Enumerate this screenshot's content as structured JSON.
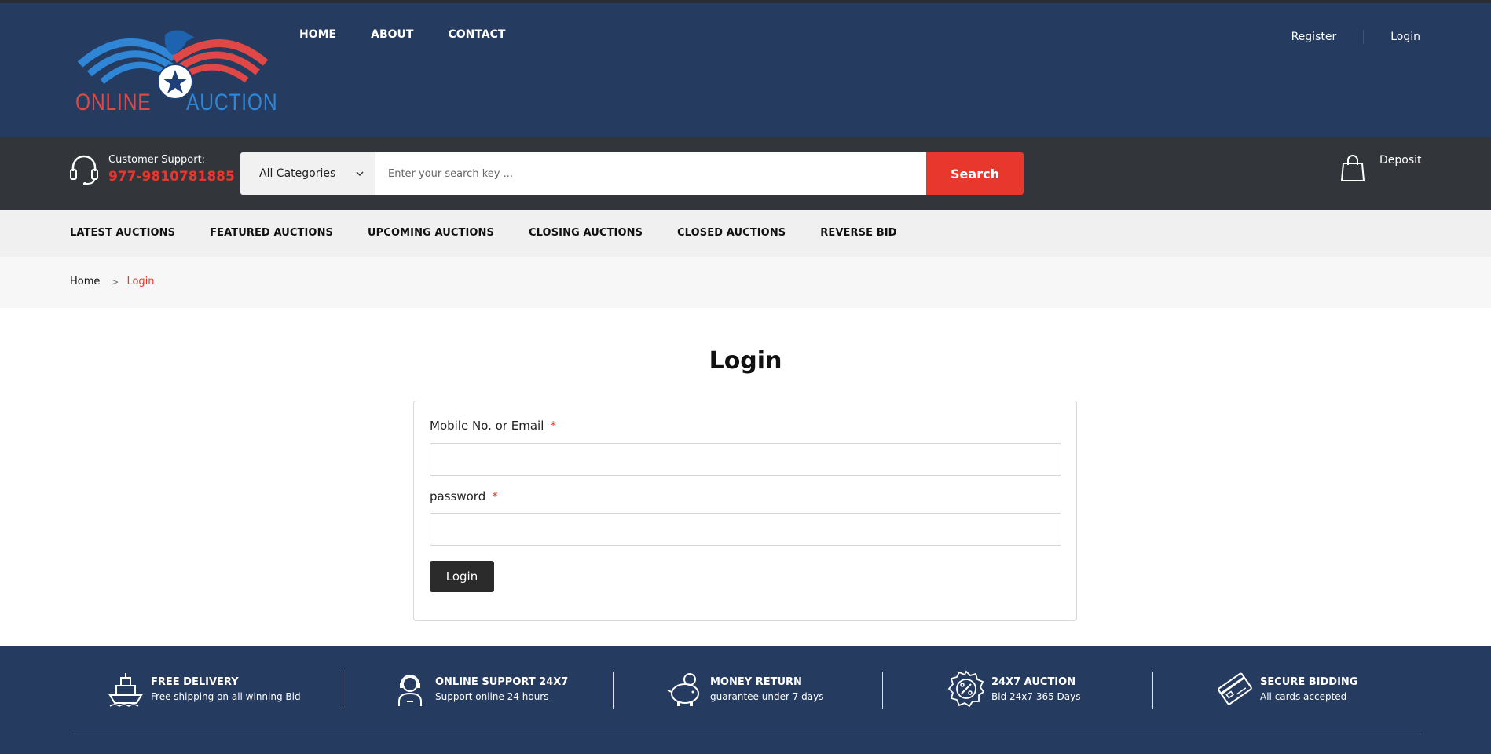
{
  "header": {
    "logo": {
      "word1": "ONLINE",
      "word2": "AUCTION"
    },
    "nav": [
      "HOME",
      "ABOUT",
      "CONTACT"
    ],
    "user_links": {
      "register": "Register",
      "login": "Login"
    }
  },
  "support": {
    "label": "Customer Support:",
    "phone": "977-9810781885"
  },
  "search": {
    "category": "All Categories",
    "placeholder": "Enter your search key ...",
    "button": "Search"
  },
  "deposit": {
    "label": "Deposit"
  },
  "category_nav": [
    "LATEST AUCTIONS",
    "FEATURED AUCTIONS",
    "UPCOMING AUCTIONS",
    "CLOSING AUCTIONS",
    "CLOSED AUCTIONS",
    "REVERSE BID"
  ],
  "breadcrumb": {
    "home": "Home",
    "current": "Login"
  },
  "login": {
    "title": "Login",
    "email_label": "Mobile No. or Email",
    "password_label": "password",
    "required_mark": "*",
    "button": "Login"
  },
  "features": [
    {
      "icon": "ship-icon",
      "title": "FREE DELIVERY",
      "subtitle": "Free shipping on all winning Bid"
    },
    {
      "icon": "support-agent-icon",
      "title": "ONLINE SUPPORT 24X7",
      "subtitle": "Support online 24 hours"
    },
    {
      "icon": "piggy-bank-icon",
      "title": "MONEY RETURN",
      "subtitle": "guarantee under 7 days"
    },
    {
      "icon": "percent-badge-icon",
      "title": "24X7 AUCTION",
      "subtitle": "Bid 24x7 365 Days"
    },
    {
      "icon": "credit-card-icon",
      "title": "SECURE BIDDING",
      "subtitle": "All cards accepted"
    }
  ],
  "colors": {
    "header_bg": "#263b60",
    "bar_bg": "#323539",
    "accent_red": "#e8372c",
    "logo_blue": "#2f86d6"
  }
}
